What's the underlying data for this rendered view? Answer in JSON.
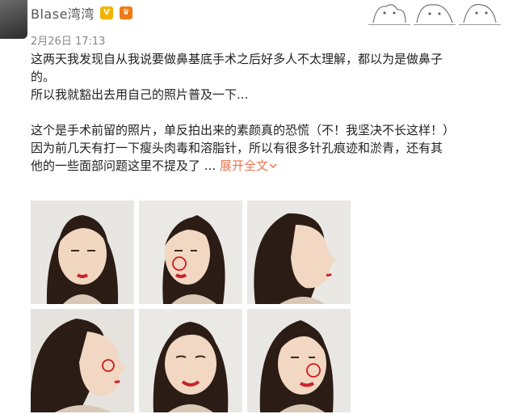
{
  "user": {
    "name": "Blase湾湾",
    "verified_icon": "verified-v-icon",
    "vip_icon": "vip-crown-icon"
  },
  "post": {
    "timestamp": "2月26日 17:13",
    "lines": [
      "这两天我发现自从我说要做鼻基底手术之后好多人不太理解，都以为是做鼻子",
      "的。",
      "所以我就豁出去用自己的照片普及一下...",
      "",
      "这个是手术前留的照片，单反拍出来的素颜真的恐慌（不！我坚决不长这样！）",
      "因为前几天有打一下瘦头肉毒和溶脂针，所以有很多针孔痕迹和淤青，还有其",
      "他的一些面部问题这里不提及了 ..."
    ],
    "expand_label": "展开全文"
  },
  "photos": [
    {
      "alt": "front-face-photo",
      "view": "front"
    },
    {
      "alt": "three-quarter-face-photo-marked",
      "view": "three-quarter"
    },
    {
      "alt": "profile-face-photo",
      "view": "profile"
    },
    {
      "alt": "profile-left-face-photo-marked",
      "view": "profile-left"
    },
    {
      "alt": "smiling-face-photo",
      "view": "smile"
    },
    {
      "alt": "three-quarter-smile-photo-marked",
      "view": "three-quarter-smile"
    }
  ],
  "colors": {
    "link": "#eb7350",
    "text": "#222222",
    "meta": "#888888",
    "marker": "#d01a1a"
  }
}
